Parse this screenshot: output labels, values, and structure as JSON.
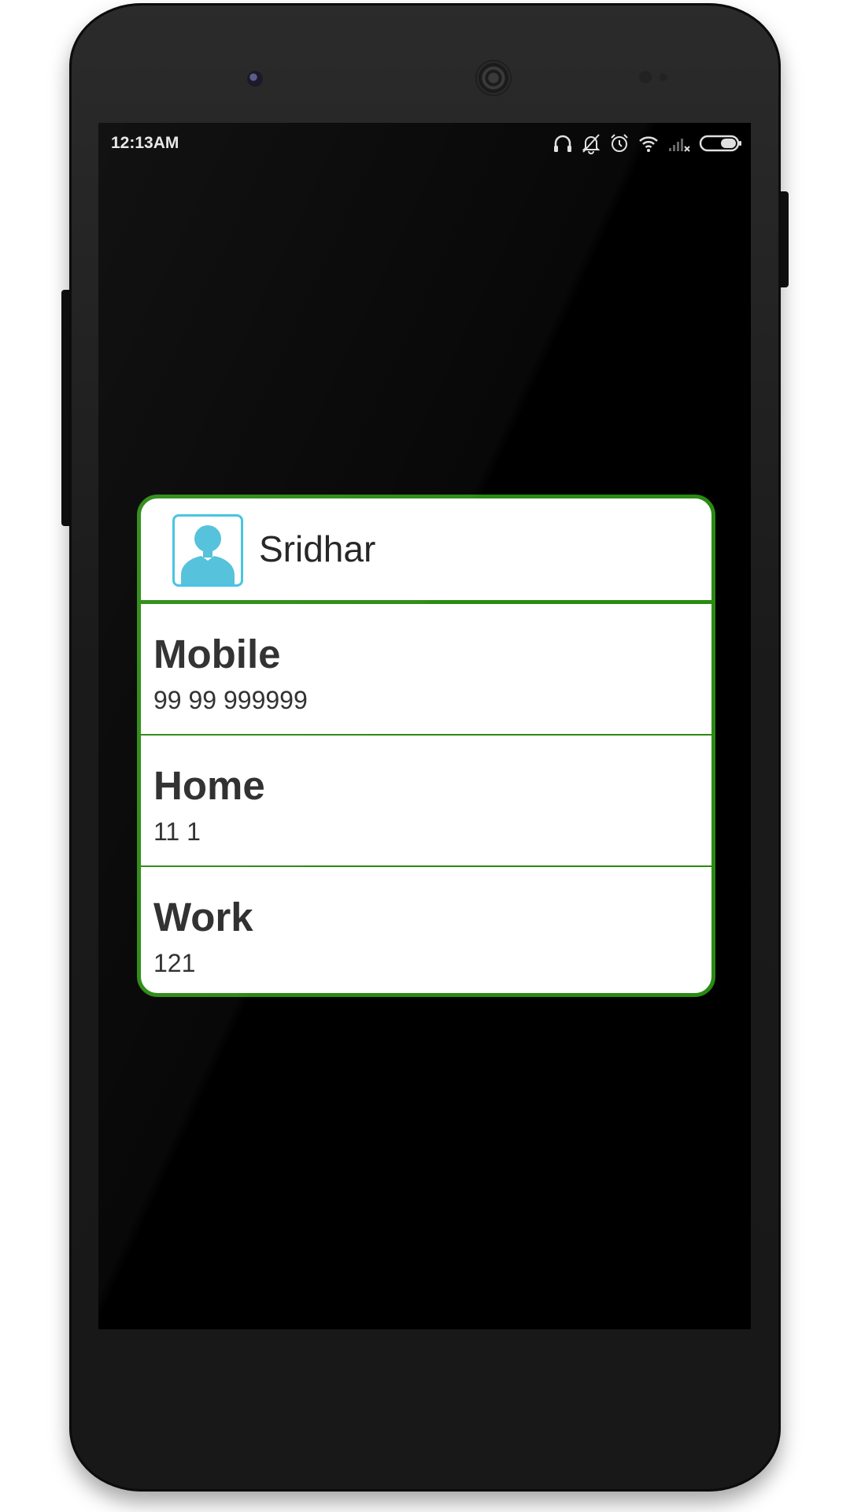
{
  "status_bar": {
    "time": "12:13AM",
    "icons": [
      "headphones-icon",
      "notifications-off-icon",
      "alarm-icon",
      "wifi-icon",
      "signal-no-service-icon",
      "battery-icon"
    ]
  },
  "contact": {
    "name": "Sridhar",
    "avatar_icon": "person-icon",
    "phones": [
      {
        "type": "Mobile",
        "number": "99 99 999999"
      },
      {
        "type": "Home",
        "number": "11 1"
      },
      {
        "type": "Work",
        "number": "121"
      }
    ]
  },
  "colors": {
    "card_border": "#2a8a12",
    "avatar_accent": "#3fc2e0",
    "screen_background": "#000000"
  }
}
